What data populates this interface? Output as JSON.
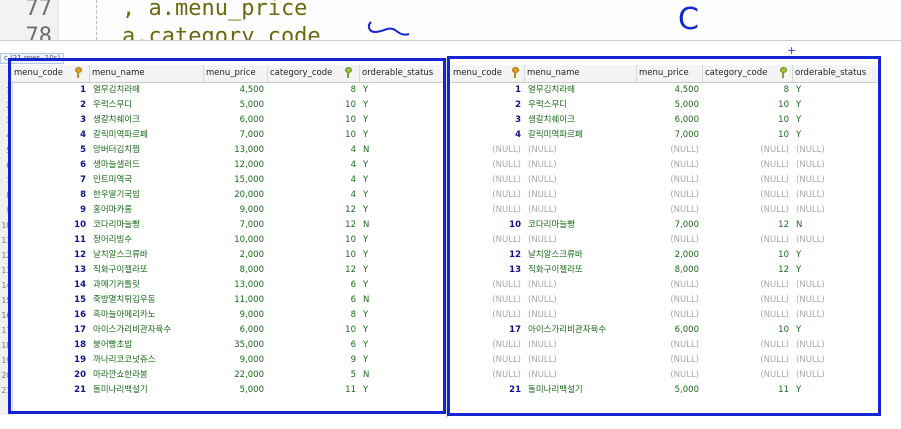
{
  "editor": {
    "lines": [
      {
        "num": "77",
        "code": ", a.menu_price"
      },
      {
        "num": "78",
        "code": "a.category_code"
      }
    ],
    "pane_tab": "c (21 rows, 10s)"
  },
  "annotations": {
    "right_mark": "C"
  },
  "left_grid": {
    "columns": [
      "menu_code",
      "menu_name",
      "menu_price",
      "category_code",
      "orderable_status"
    ],
    "rows": [
      [
        "1",
        "1",
        "열무김치라떼",
        "4,500",
        "8",
        "Y"
      ],
      [
        "2",
        "2",
        "우럭스무디",
        "5,000",
        "10",
        "Y"
      ],
      [
        "3",
        "3",
        "생갈치쉐이크",
        "6,000",
        "10",
        "Y"
      ],
      [
        "4",
        "4",
        "갈릭미역파르페",
        "7,000",
        "10",
        "Y"
      ],
      [
        "5",
        "5",
        "앙버터김치찜",
        "13,000",
        "4",
        "N"
      ],
      [
        "6",
        "6",
        "생마늘샐러드",
        "12,000",
        "4",
        "Y"
      ],
      [
        "7",
        "7",
        "민트미역국",
        "15,000",
        "4",
        "Y"
      ],
      [
        "8",
        "8",
        "한우딸기국밥",
        "20,000",
        "4",
        "Y"
      ],
      [
        "9",
        "9",
        "홍어마카롱",
        "9,000",
        "12",
        "Y"
      ],
      [
        "10",
        "10",
        "코다리마늘빵",
        "7,000",
        "12",
        "N"
      ],
      [
        "11",
        "11",
        "정어리빙수",
        "10,000",
        "10",
        "Y"
      ],
      [
        "12",
        "12",
        "날치알스크류바",
        "2,000",
        "10",
        "Y"
      ],
      [
        "13",
        "13",
        "직화구이젤라또",
        "8,000",
        "12",
        "Y"
      ],
      [
        "14",
        "14",
        "과메기커틀릿",
        "13,000",
        "6",
        "Y"
      ],
      [
        "15",
        "15",
        "죽방멸치튀김우동",
        "11,000",
        "6",
        "N"
      ],
      [
        "16",
        "16",
        "흑마늘아메리카노",
        "9,000",
        "8",
        "Y"
      ],
      [
        "17",
        "17",
        "아이스가리비관자육수",
        "6,000",
        "10",
        "Y"
      ],
      [
        "18",
        "18",
        "붕어빵초밥",
        "35,000",
        "6",
        "Y"
      ],
      [
        "19",
        "19",
        "까나리코코넛쥬스",
        "9,000",
        "9",
        "Y"
      ],
      [
        "20",
        "20",
        "마라깐쇼한라봉",
        "22,000",
        "5",
        "N"
      ],
      [
        "21",
        "21",
        "돌미나리백설기",
        "5,000",
        "11",
        "Y"
      ]
    ]
  },
  "right_grid": {
    "columns": [
      "menu_code",
      "menu_name",
      "menu_price",
      "category_code",
      "orderable_status"
    ],
    "rows": [
      [
        "1",
        "열무김치라떼",
        "4,500",
        "8",
        "Y"
      ],
      [
        "2",
        "우럭스무디",
        "5,000",
        "10",
        "Y"
      ],
      [
        "3",
        "생갈치쉐이크",
        "6,000",
        "10",
        "Y"
      ],
      [
        "4",
        "갈릭미역파르페",
        "7,000",
        "10",
        "Y"
      ],
      [
        "(NULL)",
        "(NULL)",
        "(NULL)",
        "(NULL)",
        "(NULL)"
      ],
      [
        "(NULL)",
        "(NULL)",
        "(NULL)",
        "(NULL)",
        "(NULL)"
      ],
      [
        "(NULL)",
        "(NULL)",
        "(NULL)",
        "(NULL)",
        "(NULL)"
      ],
      [
        "(NULL)",
        "(NULL)",
        "(NULL)",
        "(NULL)",
        "(NULL)"
      ],
      [
        "(NULL)",
        "(NULL)",
        "(NULL)",
        "(NULL)",
        "(NULL)"
      ],
      [
        "10",
        "코다리마늘빵",
        "7,000",
        "12",
        "N"
      ],
      [
        "(NULL)",
        "(NULL)",
        "(NULL)",
        "(NULL)",
        "(NULL)"
      ],
      [
        "12",
        "날치알스크류바",
        "2,000",
        "10",
        "Y"
      ],
      [
        "13",
        "직화구이젤라또",
        "8,000",
        "12",
        "Y"
      ],
      [
        "(NULL)",
        "(NULL)",
        "(NULL)",
        "(NULL)",
        "(NULL)"
      ],
      [
        "(NULL)",
        "(NULL)",
        "(NULL)",
        "(NULL)",
        "(NULL)"
      ],
      [
        "(NULL)",
        "(NULL)",
        "(NULL)",
        "(NULL)",
        "(NULL)"
      ],
      [
        "17",
        "아이스가리비관자육수",
        "6,000",
        "10",
        "Y"
      ],
      [
        "(NULL)",
        "(NULL)",
        "(NULL)",
        "(NULL)",
        "(NULL)"
      ],
      [
        "(NULL)",
        "(NULL)",
        "(NULL)",
        "(NULL)",
        "(NULL)"
      ],
      [
        "(NULL)",
        "(NULL)",
        "(NULL)",
        "(NULL)",
        "(NULL)"
      ],
      [
        "21",
        "돌미나리백설기",
        "5,000",
        "11",
        "Y"
      ]
    ]
  },
  "colors": {
    "highlight_box": "#1424d0",
    "value_text": "#1a6a1a",
    "null_text": "#a8a8a8"
  }
}
